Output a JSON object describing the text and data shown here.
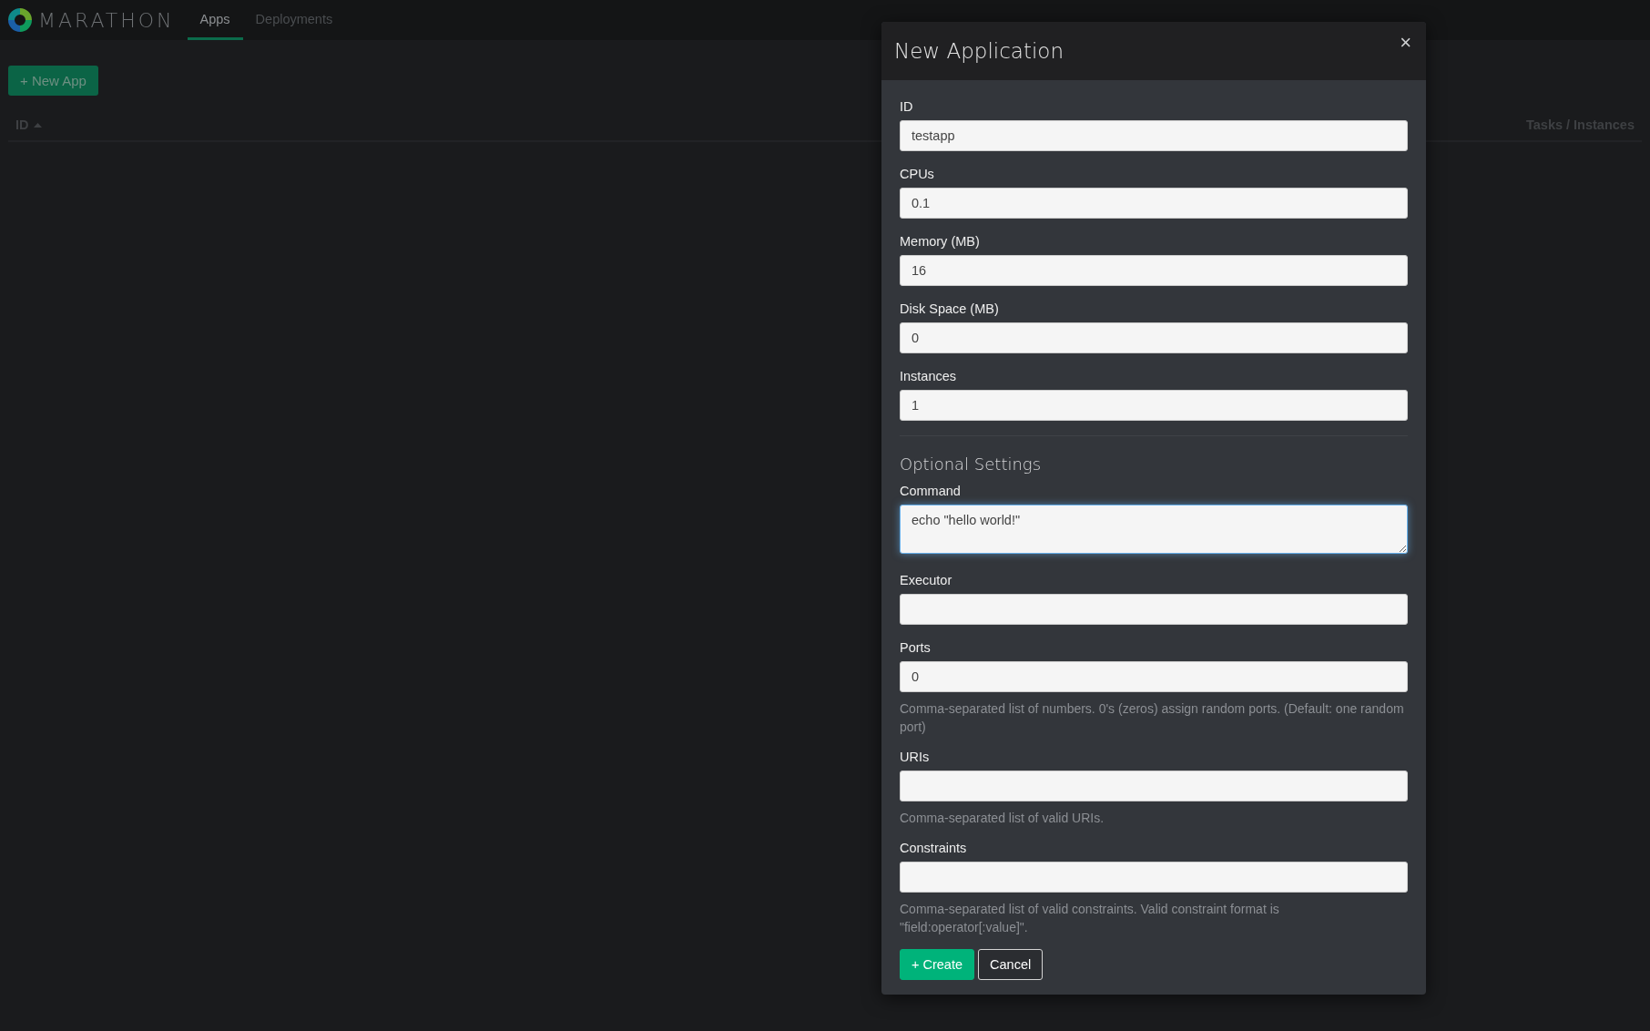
{
  "navbar": {
    "brand": "MARATHON",
    "tabs": [
      {
        "label": "Apps",
        "selected": true
      },
      {
        "label": "Deployments",
        "selected": false
      }
    ]
  },
  "new_app_button": "+ New App",
  "table": {
    "columns": [
      {
        "label": "ID",
        "sorted": true
      },
      {
        "label": "Tasks / Instances",
        "sorted": false
      }
    ]
  },
  "modal": {
    "title": "New Application",
    "close": "×",
    "fields": [
      {
        "label": "ID",
        "kind": "input",
        "value": "testapp"
      },
      {
        "label": "CPUs",
        "kind": "input",
        "value": "0.1"
      },
      {
        "label": "Memory (MB)",
        "kind": "input",
        "value": "16"
      },
      {
        "label": "Disk Space (MB)",
        "kind": "input",
        "value": "0"
      },
      {
        "label": "Instances",
        "kind": "input",
        "value": "1"
      }
    ],
    "optional_section": {
      "title": "Optional Settings",
      "fields": [
        {
          "label": "Command",
          "kind": "textarea",
          "value": "echo \"hello world!\""
        },
        {
          "label": "Executor",
          "kind": "input"
        },
        {
          "label": "Ports",
          "kind": "input",
          "value": "0",
          "help": "Comma-separated list of numbers. 0's (zeros) assign random ports. (Default: one random port)"
        },
        {
          "label": "URIs",
          "kind": "input",
          "help": "Comma-separated list of valid URIs."
        },
        {
          "label": "Constraints",
          "kind": "input",
          "help": "Comma-separated list of valid constraints. Valid constraint format is \"field:operator[:value]\"."
        }
      ]
    },
    "buttons": [
      {
        "label": "+ Create",
        "kind": "primary"
      },
      {
        "label": "Cancel",
        "kind": "secondary"
      }
    ]
  }
}
